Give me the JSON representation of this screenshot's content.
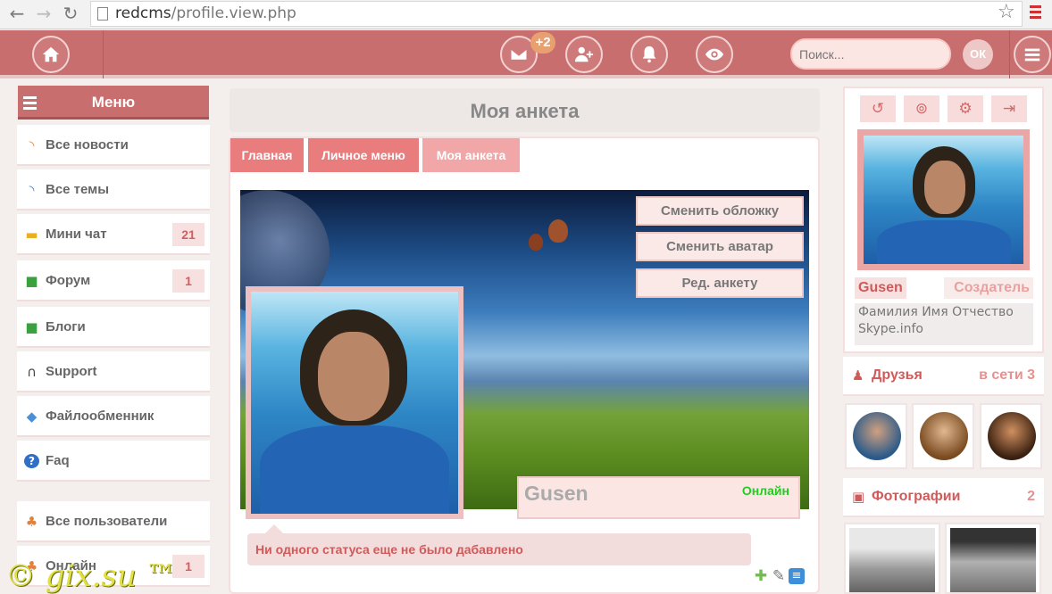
{
  "browser": {
    "url_domain": "redcms",
    "url_path": "/profile.view.php"
  },
  "topnav": {
    "messages_badge": "+2",
    "search_placeholder": "Поиск...",
    "search_button": "ОК"
  },
  "sidebar": {
    "header": "Меню",
    "items": [
      {
        "label": "Все новости",
        "icon": "rss-icon",
        "count": ""
      },
      {
        "label": "Все темы",
        "icon": "rss-icon",
        "count": ""
      },
      {
        "label": "Мини чат",
        "icon": "chat-icon",
        "count": "21"
      },
      {
        "label": "Форум",
        "icon": "forum-icon",
        "count": "1"
      },
      {
        "label": "Блоги",
        "icon": "blog-icon",
        "count": ""
      },
      {
        "label": "Support",
        "icon": "headset-icon",
        "count": ""
      },
      {
        "label": "Файлообменник",
        "icon": "file-exchange-icon",
        "count": ""
      },
      {
        "label": "Faq",
        "icon": "help-icon",
        "count": ""
      },
      {
        "label": "Все пользователи",
        "icon": "users-icon",
        "count": ""
      },
      {
        "label": "Онлайн",
        "icon": "online-users-icon",
        "count": "1"
      }
    ]
  },
  "main": {
    "title": "Моя анкета",
    "tabs": [
      "Главная",
      "Личное меню",
      "Моя анкета"
    ],
    "cover_buttons": [
      "Сменить обложку",
      "Сменить аватар",
      "Ред. анкету"
    ],
    "username": "Gusen",
    "online_status": "Онлайн",
    "status_text": "Ни одного статуса еще не было дабавлено"
  },
  "profile_card": {
    "username": "Gusen",
    "role": "Создатель",
    "full_name": "Фамилия Имя Отчество",
    "skype": "Skype.info"
  },
  "friends": {
    "title": "Друзья",
    "online_label": "в сети 3"
  },
  "photos": {
    "title": "Фотографии",
    "count": "2"
  },
  "watermark": "© gix.su ™",
  "colors": {
    "accent": "#c86e6e",
    "online": "#22cc22",
    "status_text": "#d05a5a"
  }
}
